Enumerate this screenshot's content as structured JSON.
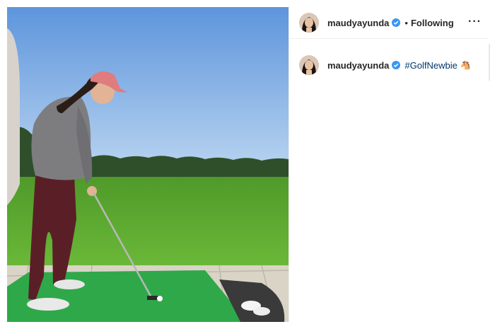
{
  "post": {
    "username": "maudyayunda",
    "follow_status": "Following",
    "dot": "•",
    "more_label": "···"
  },
  "caption": {
    "username": "maudyayunda",
    "hashtag": "#GolfNewbie",
    "emoji": "🐴",
    "truncated_text": "..."
  },
  "icons": {
    "verified": "verified-badge-icon",
    "more": "more-options-icon"
  },
  "colors": {
    "verified_blue": "#3897f0",
    "hashtag_blue": "#00376b",
    "sky": "#7fb0e6",
    "grass": "#5aa32a",
    "mat": "#2fa84a"
  }
}
